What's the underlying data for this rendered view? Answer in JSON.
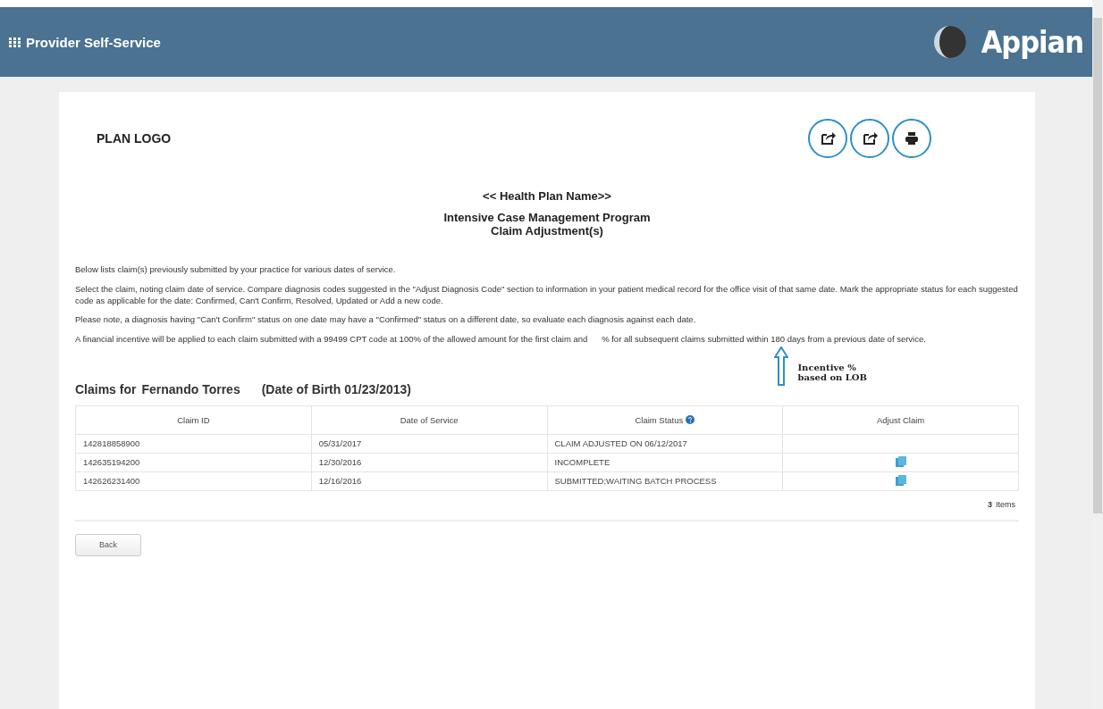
{
  "header": {
    "title": "Provider Self-Service",
    "brand": "Appian"
  },
  "plan_logo": "PLAN LOGO",
  "export_buttons": [
    {
      "kind": "export"
    },
    {
      "kind": "export"
    },
    {
      "kind": "print"
    }
  ],
  "health_plan_name": "<< Health Plan Name>>",
  "program_title": "Intensive Case Management Program",
  "page_title": "Claim Adjustment(s)",
  "paragraphs": [
    "Below lists claim(s) previously submitted by your practice for various dates of service.",
    "Select the claim, noting claim date of service. Compare diagnosis codes suggested in the \"Adjust Diagnosis Code\" section to information in your patient medical record for the office visit of that same date. Mark the appropriate status for each suggested code as applicable for the date: Confirmed, Can't Confirm, Resolved, Updated or Add a new code.",
    "Please note, a diagnosis having \"Can't Confirm\" status on one date may have a \"Confirmed\" status on a different date, so evaluate each diagnosis against each date.",
    "A financial incentive will be applied to each claim submitted with a 99499 CPT code at 100% of the allowed amount for the first claim and      % for all subsequent claims submitted within 180 days from a previous date of service."
  ],
  "annotation": {
    "line1": "Incentive %",
    "line2": "based on LOB"
  },
  "claims_heading": {
    "label": "Claims for",
    "name": "Fernando Torres",
    "dob": "(Date of Birth 01/23/2013)"
  },
  "table": {
    "columns": [
      "Claim ID",
      "Date of Service",
      "Claim Status",
      "Adjust Claim"
    ],
    "rows": [
      {
        "claim_id": "142818858900",
        "date": "05/31/2017",
        "status": "CLAIM ADJUSTED ON 06/12/2017",
        "adjustable": false
      },
      {
        "claim_id": "142635194200",
        "date": "12/30/2016",
        "status": "INCOMPLETE",
        "adjustable": true
      },
      {
        "claim_id": "142626231400",
        "date": "12/16/2016",
        "status": "SUBMITTED;WAITING BATCH PROCESS",
        "adjustable": true
      }
    ],
    "count": "3",
    "count_label": "Items"
  },
  "back_button": "Back"
}
